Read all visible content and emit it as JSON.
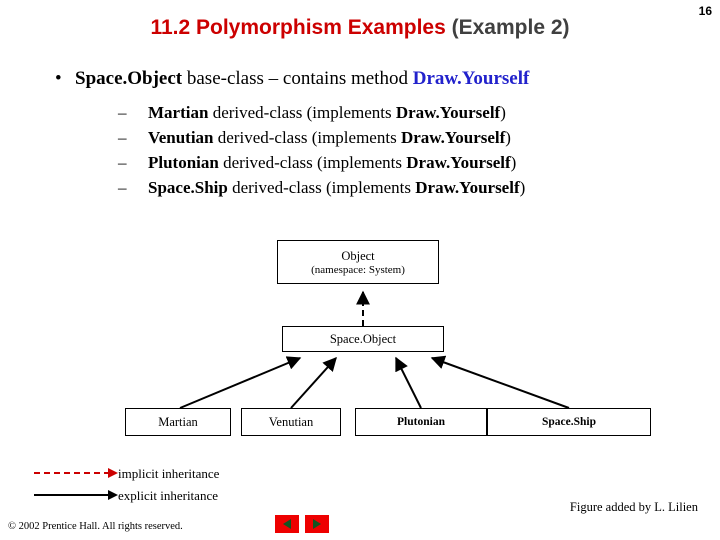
{
  "slide": {
    "number": "16",
    "title_main": "11.2 Polymorphism Examples",
    "title_sub": "(Example 2)",
    "bullet": {
      "marker": "•",
      "part1": "Space.Object",
      "part2": " base-class – contains method ",
      "part3": "Draw.Yourself"
    },
    "sub_items": [
      {
        "dash": "–",
        "name": "Martian",
        "rest": " derived-class (implements ",
        "method": "Draw.Yourself",
        "close": ")"
      },
      {
        "dash": "–",
        "name": "Venutian",
        "rest": " derived-class (implements ",
        "method": "Draw.Yourself",
        "close": ")"
      },
      {
        "dash": "–",
        "name": "Plutonian",
        "rest": " derived-class (implements ",
        "method": "Draw.Yourself",
        "close": ")"
      },
      {
        "dash": "–",
        "name": "Space.Ship",
        "rest": " derived-class (implements ",
        "method": "Draw.Yourself",
        "close": ")"
      }
    ],
    "diagram": {
      "object_box_line1": "Object",
      "object_box_line2": "(namespace: System)",
      "spaceobject_box": "Space.Object",
      "leaf_boxes": [
        "Martian",
        "Venutian",
        "Plutonian",
        "Space.Ship"
      ]
    },
    "legend": {
      "implicit": "implicit inheritance",
      "explicit": "explicit inheritance"
    },
    "figure_credit": "Figure added by L. Lilien",
    "copyright": "© 2002 Prentice Hall.  All rights reserved.",
    "nav": {
      "prev": "previous-slide",
      "next": "next-slide"
    },
    "colors": {
      "title_accent": "#cc0000",
      "title_sub": "#404040",
      "link_blue": "#2222cc",
      "nav_button": "#ee0000"
    }
  }
}
